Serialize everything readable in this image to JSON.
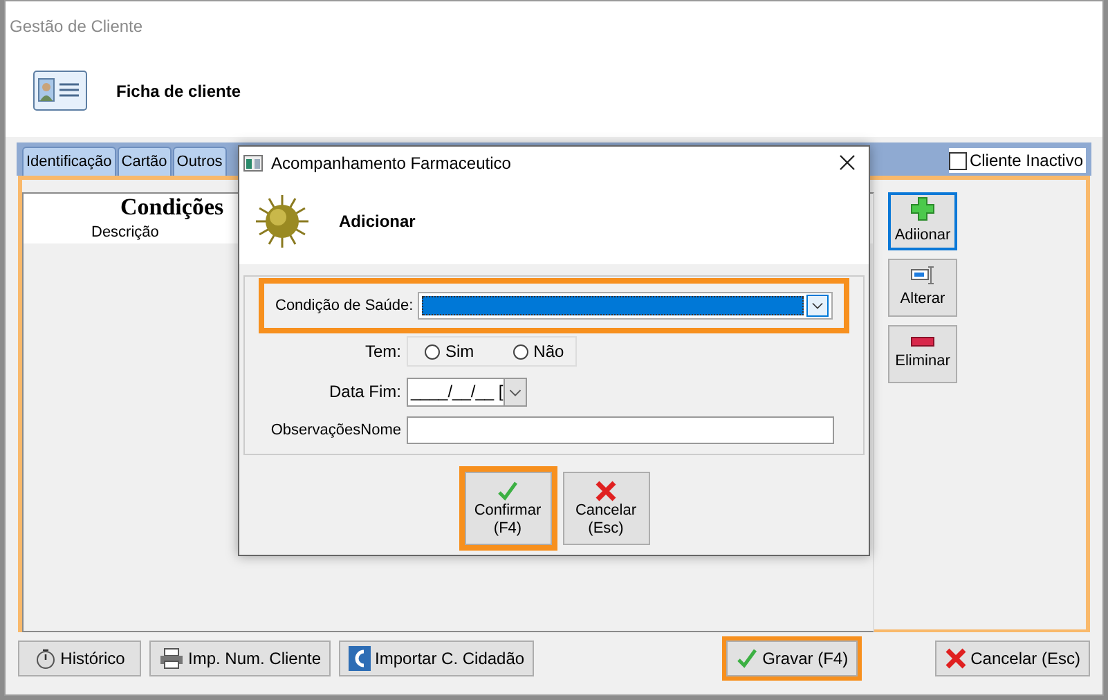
{
  "window": {
    "title": "Gestão de Cliente"
  },
  "header": {
    "title": "Ficha de cliente"
  },
  "tabs": [
    {
      "label": "Identificação",
      "selected": false
    },
    {
      "label": "Cartão",
      "selected": false
    },
    {
      "label": "Outros",
      "selected": false
    }
  ],
  "inactive_checkbox": {
    "label": "Cliente Inactivo",
    "checked": false
  },
  "list": {
    "title": "Condições",
    "columns": [
      "Descrição"
    ]
  },
  "side_buttons": [
    {
      "label": "Adiionar",
      "kind": "add",
      "focused": true
    },
    {
      "label": "Alterar",
      "kind": "edit",
      "focused": false
    },
    {
      "label": "Eliminar",
      "kind": "delete",
      "focused": false
    }
  ],
  "footer_buttons": [
    {
      "label": "Histórico",
      "kind": "history",
      "highlighted": false
    },
    {
      "label": "Imp. Num. Cliente",
      "kind": "print",
      "highlighted": false
    },
    {
      "label": "Importar C. Cidadão",
      "kind": "import",
      "highlighted": false
    },
    {
      "label": "Gravar (F4)",
      "kind": "save",
      "highlighted": true
    },
    {
      "label": "Cancelar (Esc)",
      "kind": "cancel",
      "highlighted": false
    }
  ],
  "dialog": {
    "title": "Acompanhamento Farmaceutico",
    "heading": "Adicionar",
    "fields": [
      {
        "kind": "select",
        "label": "Condição de Saúde:",
        "highlighted": true
      },
      {
        "kind": "radio",
        "label": "Tem:",
        "options": [
          {
            "label": "Sim",
            "selected": false
          },
          {
            "label": "Não",
            "selected": false
          }
        ]
      },
      {
        "kind": "date",
        "label": "Data Fim:",
        "value": "____/__/__ ["
      },
      {
        "kind": "text",
        "label": "ObservaçõesNome"
      }
    ],
    "buttons": [
      {
        "label": "Confirmar",
        "shortcut": "(F4)",
        "kind": "confirm",
        "highlighted": true
      },
      {
        "label": "Cancelar",
        "shortcut": "(Esc)",
        "kind": "cancel",
        "highlighted": false
      }
    ]
  }
}
